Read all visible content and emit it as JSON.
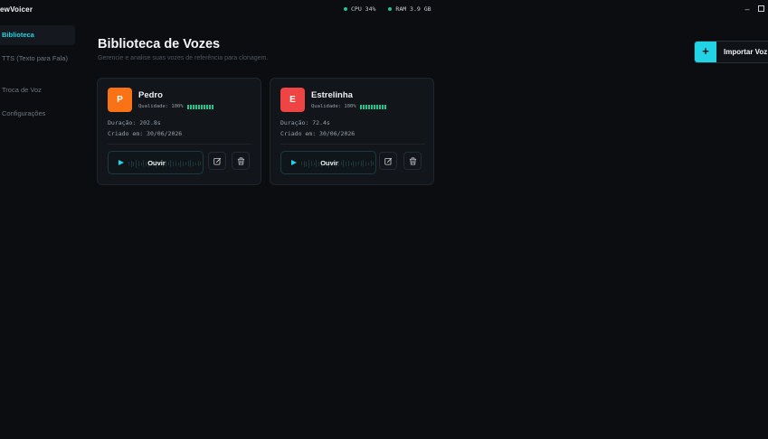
{
  "app": {
    "title": "ewVoicer"
  },
  "stats": {
    "cpu": "CPU 34%",
    "ram": "RAM 3.9 GB"
  },
  "window": {
    "minimize_icon": "minimize-icon",
    "maximize_icon": "maximize-icon"
  },
  "sidebar": {
    "items": [
      {
        "label": "Biblioteca",
        "active": true
      },
      {
        "label": "TTS (Texto para Fala)",
        "active": false
      },
      {
        "label": "Troca de Voz",
        "active": false
      },
      {
        "label": "Configurações",
        "active": false
      }
    ]
  },
  "page": {
    "title": "Biblioteca de Vozes",
    "subtitle": "Gerencie e analise suas vozes de referência para clonagem.",
    "import_label": "Importar Voz",
    "import_icon": "+"
  },
  "voices": [
    {
      "initial": "P",
      "name": "Pedro",
      "quality": "Qualidade: 100%",
      "duration": "Duração: 202.8s",
      "created": "Criado em: 30/06/2026",
      "play_label": "Ouvir",
      "avatar_color": "#f97316"
    },
    {
      "initial": "E",
      "name": "Estrelinha",
      "quality": "Qualidade: 100%",
      "duration": "Duração: 72.4s",
      "created": "Criado em: 30/06/2026",
      "play_label": "Ouvir",
      "avatar_color": "#ef4444"
    }
  ],
  "colors": {
    "accent": "#22d3e6",
    "success": "#22c58b",
    "background": "#0b0d10"
  }
}
